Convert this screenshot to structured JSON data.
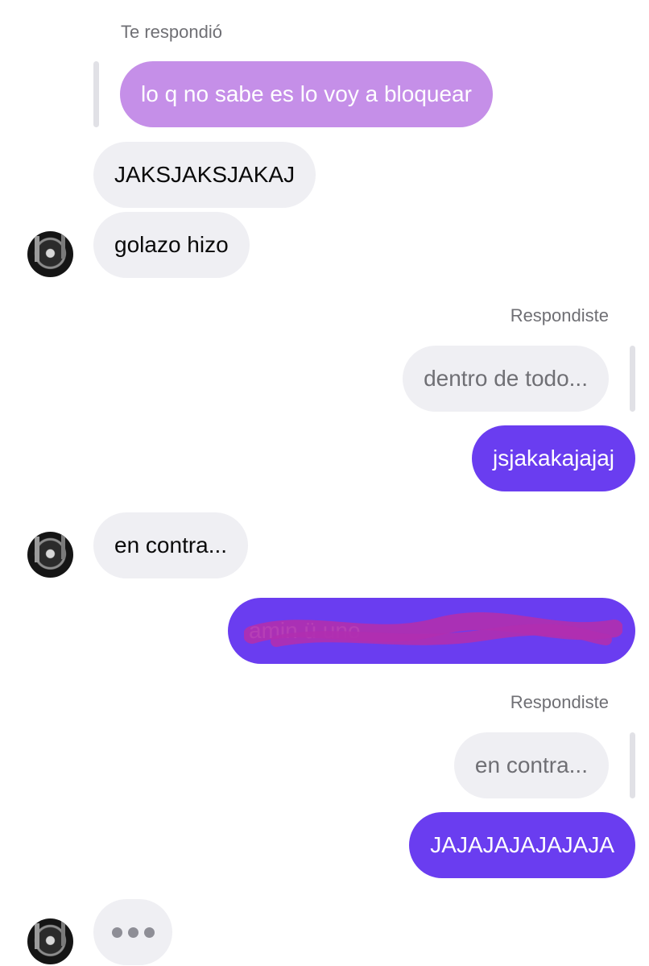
{
  "labels": {
    "replied_to_you": "Te respondió",
    "you_replied_1": "Respondiste",
    "you_replied_2": "Respondiste"
  },
  "messages": {
    "quoted_received": "lo q no sabe es lo voy a bloquear",
    "recv_1": "JAKSJAKSJAKAJ",
    "recv_2": "golazo hizo",
    "quoted_sent_1": "dentro de todo...",
    "sent_1": "jsjakakajajaj",
    "recv_3": "en contra...",
    "sent_redacted": "amin                     ü             uno",
    "quoted_sent_2": "en contra...",
    "sent_2": "JAJAJAJAJAJAJA"
  },
  "icons": {
    "avatar": "contact-avatar-icon",
    "typing": "typing-indicator-icon"
  },
  "colors": {
    "sent_bubble": "#6a3df0",
    "received_bubble": "#efeff3",
    "quoted_received_bubble": "#c58fe8",
    "redaction_scribble": "#b02fb0"
  }
}
